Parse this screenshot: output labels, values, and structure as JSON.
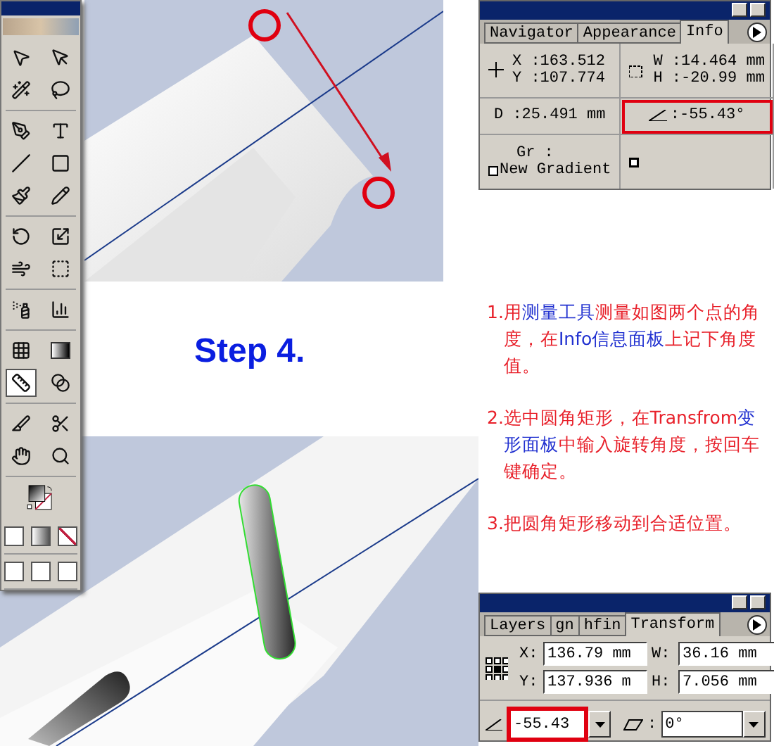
{
  "toolbox": {
    "tools": [
      {
        "selected": false
      },
      {
        "selected": false
      },
      {
        "selected": false
      },
      {
        "selected": false
      },
      {
        "selected": false
      },
      {
        "selected": false
      },
      {
        "selected": false
      },
      {
        "selected": false
      },
      {
        "selected": false
      },
      {
        "selected": false
      },
      {
        "selected": false
      },
      {
        "selected": false
      },
      {
        "selected": false
      },
      {
        "selected": false
      },
      {
        "selected": false
      },
      {
        "selected": false
      },
      {
        "selected": true
      },
      {
        "selected": false
      },
      {
        "selected": false
      },
      {
        "selected": false
      },
      {
        "selected": false
      },
      {
        "selected": false
      }
    ]
  },
  "step_title": "Step 4.",
  "info_panel": {
    "tabs": [
      {
        "label": "Navigator",
        "selected": false
      },
      {
        "label": "Appearance",
        "selected": false
      },
      {
        "label": "Info",
        "selected": true
      }
    ],
    "x": "X :163.512",
    "y": "Y :107.774",
    "w": "W :14.464 mm",
    "h": "H :-20.99 mm",
    "d": "D :25.491 mm",
    "angle": ":-55.43°",
    "angle_highlighted": true,
    "gr": "Gr :",
    "gradient": "New Gradient"
  },
  "instructions": [
    {
      "segments": [
        {
          "text": "1.用",
          "highlight": false
        },
        {
          "text": "测量工具",
          "highlight": true
        },
        {
          "text": "测量如图两个点的角度，在",
          "highlight": false
        },
        {
          "text": "Info信息面板",
          "highlight": true
        },
        {
          "text": "上记下角度值。",
          "highlight": false
        }
      ]
    },
    {
      "segments": [
        {
          "text": "2.选中圆角矩形，在Transfrom",
          "highlight": false
        },
        {
          "text": "变形面板",
          "highlight": true
        },
        {
          "text": "中输入旋转角度，按回车键确定。",
          "highlight": false
        }
      ]
    },
    {
      "segments": [
        {
          "text": "3.把圆角矩形移动到合适位置。",
          "highlight": false
        }
      ]
    }
  ],
  "transform_panel": {
    "tabs": [
      {
        "label": "Layers",
        "selected": false
      },
      {
        "label": "gn",
        "selected": false
      },
      {
        "label": "hfin",
        "selected": false
      },
      {
        "label": "Transform",
        "selected": true
      }
    ],
    "fields": [
      {
        "label": "X:",
        "value": "136.79 mm"
      },
      {
        "label": "W:",
        "value": "36.16 mm"
      },
      {
        "label": "Y:",
        "value": "137.936 m"
      },
      {
        "label": "H:",
        "value": "7.056 mm"
      }
    ],
    "rotate": "-55.43",
    "rotate_highlighted": true,
    "shear_label": ":",
    "shear": "0°"
  }
}
